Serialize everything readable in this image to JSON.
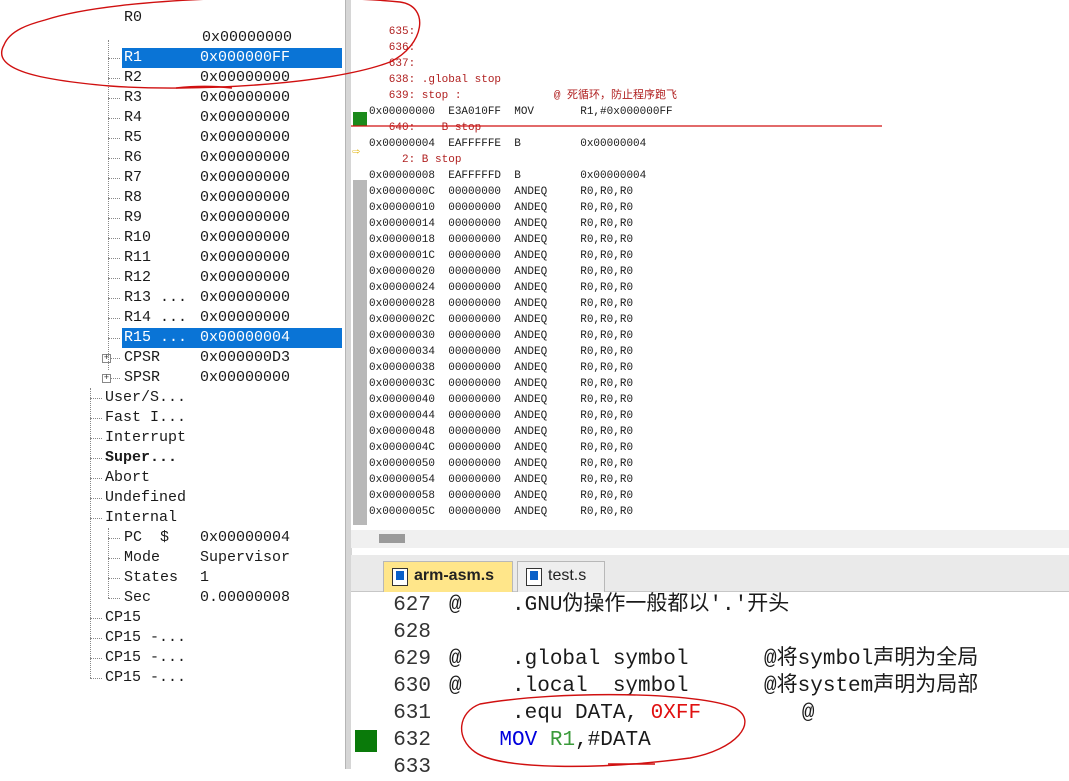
{
  "registers": [
    {
      "name": "R1",
      "value": "0x000000FF",
      "selected": true
    },
    {
      "name": "R2",
      "value": "0x00000000",
      "selected": false
    },
    {
      "name": "R3",
      "value": "0x00000000",
      "selected": false
    },
    {
      "name": "R4",
      "value": "0x00000000",
      "selected": false
    },
    {
      "name": "R5",
      "value": "0x00000000",
      "selected": false
    },
    {
      "name": "R6",
      "value": "0x00000000",
      "selected": false
    },
    {
      "name": "R7",
      "value": "0x00000000",
      "selected": false
    },
    {
      "name": "R8",
      "value": "0x00000000",
      "selected": false
    },
    {
      "name": "R9",
      "value": "0x00000000",
      "selected": false
    },
    {
      "name": "R10",
      "value": "0x00000000",
      "selected": false
    },
    {
      "name": "R11",
      "value": "0x00000000",
      "selected": false
    },
    {
      "name": "R12",
      "value": "0x00000000",
      "selected": false
    },
    {
      "name": "R13 ...",
      "value": "0x00000000",
      "selected": false
    },
    {
      "name": "R14 ...",
      "value": "0x00000000",
      "selected": false
    },
    {
      "name": "R15 ...",
      "value": "0x00000004",
      "selected": true
    },
    {
      "name": "CPSR",
      "value": "0x000000D3",
      "selected": false
    },
    {
      "name": "SPSR",
      "value": "0x00000000",
      "selected": false
    }
  ],
  "modes": [
    {
      "label": "User/S...",
      "bold": false
    },
    {
      "label": "Fast I...",
      "bold": false
    },
    {
      "label": "Interrupt",
      "bold": false
    },
    {
      "label": "Super...",
      "bold": true
    },
    {
      "label": "Abort",
      "bold": false
    },
    {
      "label": "Undefined",
      "bold": false
    },
    {
      "label": "Internal",
      "bold": false
    }
  ],
  "internal": [
    {
      "name": "PC  $",
      "value": "0x00000004"
    },
    {
      "name": "Mode",
      "value": "Supervisor"
    },
    {
      "name": "States",
      "value": "1"
    },
    {
      "name": "Sec",
      "value": "0.00000008"
    }
  ],
  "cp15": [
    "CP15",
    "CP15 -...",
    "CP15 -...",
    "CP15 -..."
  ],
  "disasm_lines": [
    {
      "text": "   635:",
      "type": "src"
    },
    {
      "text": "   636:",
      "type": "src"
    },
    {
      "text": "   637:",
      "type": "src"
    },
    {
      "text": "   638: .global stop",
      "type": "src"
    },
    {
      "text": "   639: stop :              @ 死循环，防止程序跑飞",
      "type": "src"
    },
    {
      "text": "0x00000000  E3A010FF  MOV       R1,#0x000000FF",
      "type": "asm"
    },
    {
      "text": "   640:    B stop",
      "type": "src"
    },
    {
      "text": "0x00000004  EAFFFFFE  B         0x00000004",
      "type": "asm"
    },
    {
      "text": "     2: B stop",
      "type": "src"
    },
    {
      "text": "0x00000008  EAFFFFFD  B         0x00000004",
      "type": "asm"
    },
    {
      "text": "0x0000000C  00000000  ANDEQ     R0,R0,R0",
      "type": "asm"
    },
    {
      "text": "0x00000010  00000000  ANDEQ     R0,R0,R0",
      "type": "asm"
    },
    {
      "text": "0x00000014  00000000  ANDEQ     R0,R0,R0",
      "type": "asm"
    },
    {
      "text": "0x00000018  00000000  ANDEQ     R0,R0,R0",
      "type": "asm"
    },
    {
      "text": "0x0000001C  00000000  ANDEQ     R0,R0,R0",
      "type": "asm"
    },
    {
      "text": "0x00000020  00000000  ANDEQ     R0,R0,R0",
      "type": "asm"
    },
    {
      "text": "0x00000024  00000000  ANDEQ     R0,R0,R0",
      "type": "asm"
    },
    {
      "text": "0x00000028  00000000  ANDEQ     R0,R0,R0",
      "type": "asm"
    },
    {
      "text": "0x0000002C  00000000  ANDEQ     R0,R0,R0",
      "type": "asm"
    },
    {
      "text": "0x00000030  00000000  ANDEQ     R0,R0,R0",
      "type": "asm"
    },
    {
      "text": "0x00000034  00000000  ANDEQ     R0,R0,R0",
      "type": "asm"
    },
    {
      "text": "0x00000038  00000000  ANDEQ     R0,R0,R0",
      "type": "asm"
    },
    {
      "text": "0x0000003C  00000000  ANDEQ     R0,R0,R0",
      "type": "asm"
    },
    {
      "text": "0x00000040  00000000  ANDEQ     R0,R0,R0",
      "type": "asm"
    },
    {
      "text": "0x00000044  00000000  ANDEQ     R0,R0,R0",
      "type": "asm"
    },
    {
      "text": "0x00000048  00000000  ANDEQ     R0,R0,R0",
      "type": "asm"
    },
    {
      "text": "0x0000004C  00000000  ANDEQ     R0,R0,R0",
      "type": "asm"
    },
    {
      "text": "0x00000050  00000000  ANDEQ     R0,R0,R0",
      "type": "asm"
    },
    {
      "text": "0x00000054  00000000  ANDEQ     R0,R0,R0",
      "type": "asm"
    },
    {
      "text": "0x00000058  00000000  ANDEQ     R0,R0,R0",
      "type": "asm"
    },
    {
      "text": "0x0000005C  00000000  ANDEQ     R0,R0,R0",
      "type": "asm"
    }
  ],
  "tabs": [
    {
      "label": "arm-asm.s",
      "active": true
    },
    {
      "label": "test.s",
      "active": false
    }
  ],
  "code_lines": [
    {
      "num": "627",
      "parts": [
        {
          "t": "@    .GNU伪操作一般都以'.'开头",
          "c": ""
        }
      ]
    },
    {
      "num": "628",
      "parts": [
        {
          "t": "",
          "c": ""
        }
      ]
    },
    {
      "num": "629",
      "parts": [
        {
          "t": "@    .global symbol      @将symbol声明为全局",
          "c": ""
        }
      ]
    },
    {
      "num": "630",
      "parts": [
        {
          "t": "@    .local  symbol      @将system声明为局部",
          "c": ""
        }
      ]
    },
    {
      "num": "631",
      "parts": [
        {
          "t": "     .equ DATA, ",
          "c": ""
        },
        {
          "t": "0XFF",
          "c": "red"
        },
        {
          "t": "        @",
          "c": ""
        }
      ]
    },
    {
      "num": "632",
      "parts": [
        {
          "t": "    ",
          "c": ""
        },
        {
          "t": "MOV",
          "c": "blue"
        },
        {
          "t": " ",
          "c": ""
        },
        {
          "t": "R1",
          "c": "green"
        },
        {
          "t": ",#DATA",
          "c": ""
        }
      ]
    },
    {
      "num": "633",
      "parts": [
        {
          "t": "",
          "c": ""
        }
      ]
    }
  ],
  "colors": {
    "selection": "#0a74d6",
    "annotation": "#d01010",
    "breakpoint_green": "#1b8a1b",
    "active_tab": "#ffe68a"
  }
}
